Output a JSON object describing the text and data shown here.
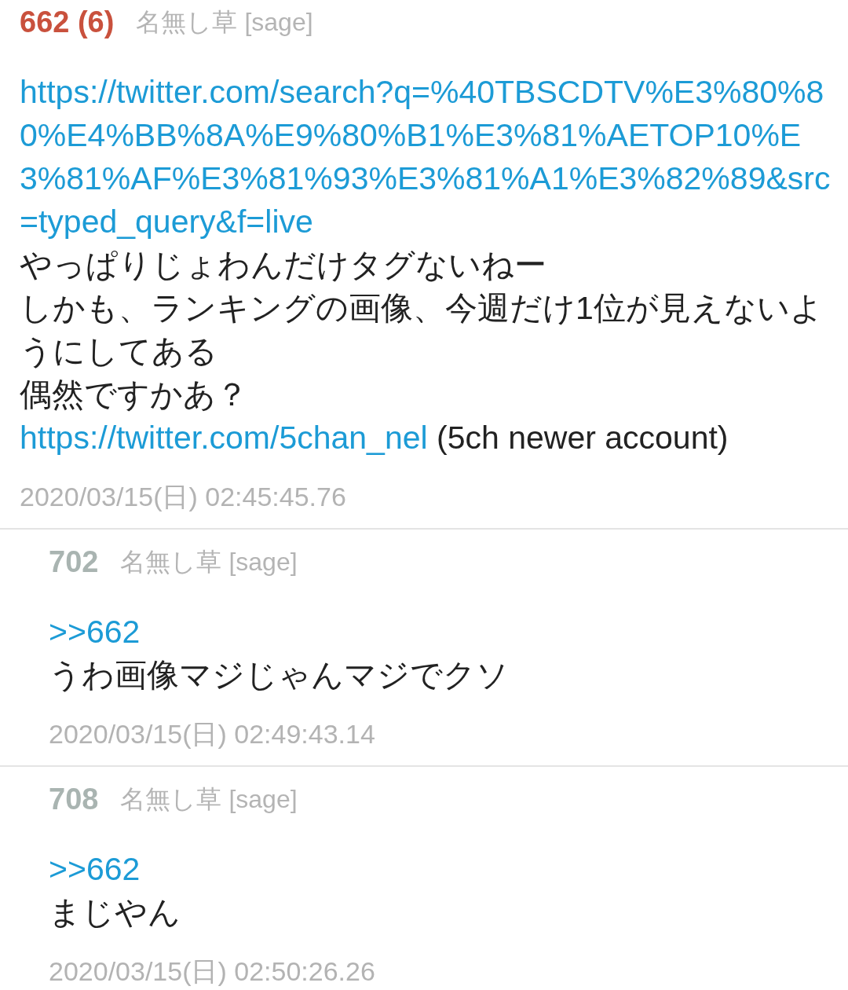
{
  "thread": {
    "posts": [
      {
        "number": "662 (6)",
        "color": "#c9513d",
        "name": "名無し草",
        "mail": "[sage]",
        "body": [
          {
            "parts": [
              {
                "kind": "link",
                "text": "https://twitter.com/search?q=%40TBSCDTV%E3%80%80%E4%BB%8A%E9%80%B1%E3%81%AETOP10%E3%81%AF%E3%81%93%E3%81%A1%E3%82%89&src=typed_query&f=live"
              }
            ]
          },
          {
            "parts": [
              {
                "kind": "text",
                "text": "やっぱりじょわんだけタグないねー"
              }
            ]
          },
          {
            "parts": [
              {
                "kind": "text",
                "text": "しかも、ランキングの画像、今週だけ1位が見えないようにしてある"
              }
            ]
          },
          {
            "parts": [
              {
                "kind": "text",
                "text": "偶然ですかあ？"
              }
            ]
          },
          {
            "parts": [
              {
                "kind": "link",
                "text": "https://twitter.com/5chan_nel"
              },
              {
                "kind": "text",
                "text": "(5ch newer account)"
              }
            ]
          }
        ],
        "date": "2020/03/15(日) 02:45:45.76",
        "children": [
          {
            "number": "702",
            "color": "#a9b4b1",
            "name": "名無し草",
            "mail": "[sage]",
            "body": [
              {
                "parts": [
                  {
                    "kind": "anchor",
                    "text": ">>662"
                  }
                ]
              },
              {
                "parts": [
                  {
                    "kind": "text",
                    "text": "うわ画像マジじゃんマジでクソ"
                  }
                ]
              }
            ],
            "date": "2020/03/15(日) 02:49:43.14"
          },
          {
            "number": "708",
            "color": "#a9b4b1",
            "name": "名無し草",
            "mail": "[sage]",
            "body": [
              {
                "parts": [
                  {
                    "kind": "anchor",
                    "text": ">>662"
                  }
                ]
              },
              {
                "parts": [
                  {
                    "kind": "text",
                    "text": "まじやん"
                  }
                ]
              }
            ],
            "date": "2020/03/15(日) 02:50:26.26"
          }
        ]
      }
    ]
  }
}
